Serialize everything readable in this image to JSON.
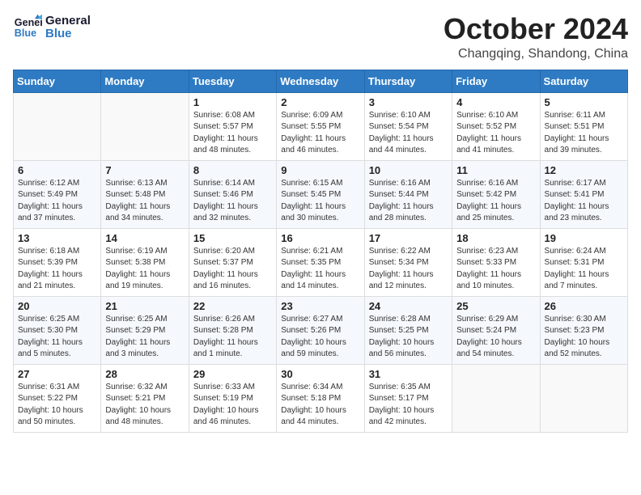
{
  "header": {
    "logo_line1": "General",
    "logo_line2": "Blue",
    "month_title": "October 2024",
    "subtitle": "Changqing, Shandong, China"
  },
  "weekdays": [
    "Sunday",
    "Monday",
    "Tuesday",
    "Wednesday",
    "Thursday",
    "Friday",
    "Saturday"
  ],
  "weeks": [
    [
      {
        "day": "",
        "info": ""
      },
      {
        "day": "",
        "info": ""
      },
      {
        "day": "1",
        "info": "Sunrise: 6:08 AM\nSunset: 5:57 PM\nDaylight: 11 hours and 48 minutes."
      },
      {
        "day": "2",
        "info": "Sunrise: 6:09 AM\nSunset: 5:55 PM\nDaylight: 11 hours and 46 minutes."
      },
      {
        "day": "3",
        "info": "Sunrise: 6:10 AM\nSunset: 5:54 PM\nDaylight: 11 hours and 44 minutes."
      },
      {
        "day": "4",
        "info": "Sunrise: 6:10 AM\nSunset: 5:52 PM\nDaylight: 11 hours and 41 minutes."
      },
      {
        "day": "5",
        "info": "Sunrise: 6:11 AM\nSunset: 5:51 PM\nDaylight: 11 hours and 39 minutes."
      }
    ],
    [
      {
        "day": "6",
        "info": "Sunrise: 6:12 AM\nSunset: 5:49 PM\nDaylight: 11 hours and 37 minutes."
      },
      {
        "day": "7",
        "info": "Sunrise: 6:13 AM\nSunset: 5:48 PM\nDaylight: 11 hours and 34 minutes."
      },
      {
        "day": "8",
        "info": "Sunrise: 6:14 AM\nSunset: 5:46 PM\nDaylight: 11 hours and 32 minutes."
      },
      {
        "day": "9",
        "info": "Sunrise: 6:15 AM\nSunset: 5:45 PM\nDaylight: 11 hours and 30 minutes."
      },
      {
        "day": "10",
        "info": "Sunrise: 6:16 AM\nSunset: 5:44 PM\nDaylight: 11 hours and 28 minutes."
      },
      {
        "day": "11",
        "info": "Sunrise: 6:16 AM\nSunset: 5:42 PM\nDaylight: 11 hours and 25 minutes."
      },
      {
        "day": "12",
        "info": "Sunrise: 6:17 AM\nSunset: 5:41 PM\nDaylight: 11 hours and 23 minutes."
      }
    ],
    [
      {
        "day": "13",
        "info": "Sunrise: 6:18 AM\nSunset: 5:39 PM\nDaylight: 11 hours and 21 minutes."
      },
      {
        "day": "14",
        "info": "Sunrise: 6:19 AM\nSunset: 5:38 PM\nDaylight: 11 hours and 19 minutes."
      },
      {
        "day": "15",
        "info": "Sunrise: 6:20 AM\nSunset: 5:37 PM\nDaylight: 11 hours and 16 minutes."
      },
      {
        "day": "16",
        "info": "Sunrise: 6:21 AM\nSunset: 5:35 PM\nDaylight: 11 hours and 14 minutes."
      },
      {
        "day": "17",
        "info": "Sunrise: 6:22 AM\nSunset: 5:34 PM\nDaylight: 11 hours and 12 minutes."
      },
      {
        "day": "18",
        "info": "Sunrise: 6:23 AM\nSunset: 5:33 PM\nDaylight: 11 hours and 10 minutes."
      },
      {
        "day": "19",
        "info": "Sunrise: 6:24 AM\nSunset: 5:31 PM\nDaylight: 11 hours and 7 minutes."
      }
    ],
    [
      {
        "day": "20",
        "info": "Sunrise: 6:25 AM\nSunset: 5:30 PM\nDaylight: 11 hours and 5 minutes."
      },
      {
        "day": "21",
        "info": "Sunrise: 6:25 AM\nSunset: 5:29 PM\nDaylight: 11 hours and 3 minutes."
      },
      {
        "day": "22",
        "info": "Sunrise: 6:26 AM\nSunset: 5:28 PM\nDaylight: 11 hours and 1 minute."
      },
      {
        "day": "23",
        "info": "Sunrise: 6:27 AM\nSunset: 5:26 PM\nDaylight: 10 hours and 59 minutes."
      },
      {
        "day": "24",
        "info": "Sunrise: 6:28 AM\nSunset: 5:25 PM\nDaylight: 10 hours and 56 minutes."
      },
      {
        "day": "25",
        "info": "Sunrise: 6:29 AM\nSunset: 5:24 PM\nDaylight: 10 hours and 54 minutes."
      },
      {
        "day": "26",
        "info": "Sunrise: 6:30 AM\nSunset: 5:23 PM\nDaylight: 10 hours and 52 minutes."
      }
    ],
    [
      {
        "day": "27",
        "info": "Sunrise: 6:31 AM\nSunset: 5:22 PM\nDaylight: 10 hours and 50 minutes."
      },
      {
        "day": "28",
        "info": "Sunrise: 6:32 AM\nSunset: 5:21 PM\nDaylight: 10 hours and 48 minutes."
      },
      {
        "day": "29",
        "info": "Sunrise: 6:33 AM\nSunset: 5:19 PM\nDaylight: 10 hours and 46 minutes."
      },
      {
        "day": "30",
        "info": "Sunrise: 6:34 AM\nSunset: 5:18 PM\nDaylight: 10 hours and 44 minutes."
      },
      {
        "day": "31",
        "info": "Sunrise: 6:35 AM\nSunset: 5:17 PM\nDaylight: 10 hours and 42 minutes."
      },
      {
        "day": "",
        "info": ""
      },
      {
        "day": "",
        "info": ""
      }
    ]
  ]
}
